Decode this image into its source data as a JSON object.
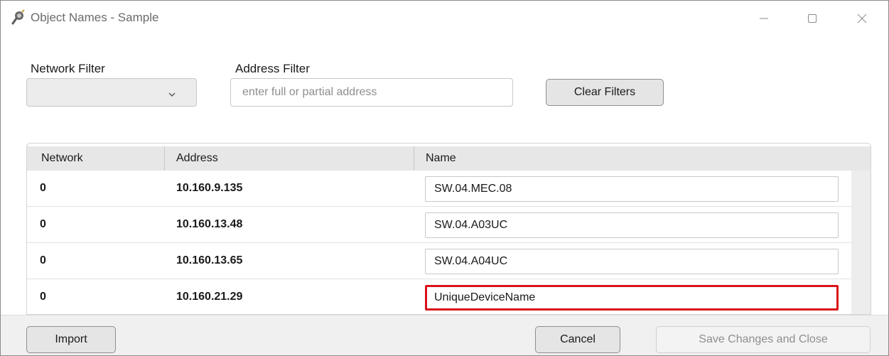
{
  "window": {
    "title": "Object Names - Sample",
    "controls": [
      "minimize-icon",
      "maximize-icon",
      "close-icon"
    ]
  },
  "filters": {
    "network_label": "Network Filter",
    "network_value": "",
    "address_label": "Address Filter",
    "address_value": "",
    "address_placeholder": "enter full or partial address",
    "clear_label": "Clear Filters"
  },
  "table": {
    "columns": [
      "Network",
      "Address",
      "Name"
    ],
    "rows": [
      {
        "network": "0",
        "address": "10.160.9.135",
        "name": "SW.04.MEC.08"
      },
      {
        "network": "0",
        "address": "10.160.13.48",
        "name": "SW.04.A03UC"
      },
      {
        "network": "0",
        "address": "10.160.13.65",
        "name": "SW.04.A04UC"
      },
      {
        "network": "0",
        "address": "10.160.21.29",
        "name": "UniqueDeviceName"
      }
    ]
  },
  "footer": {
    "import_label": "Import",
    "cancel_label": "Cancel",
    "save_label": "Save Changes and Close"
  },
  "colors": {
    "focus_border": "#d9121c",
    "header_bg": "#e7e7e7",
    "footer_bg": "#f0f0f0"
  }
}
